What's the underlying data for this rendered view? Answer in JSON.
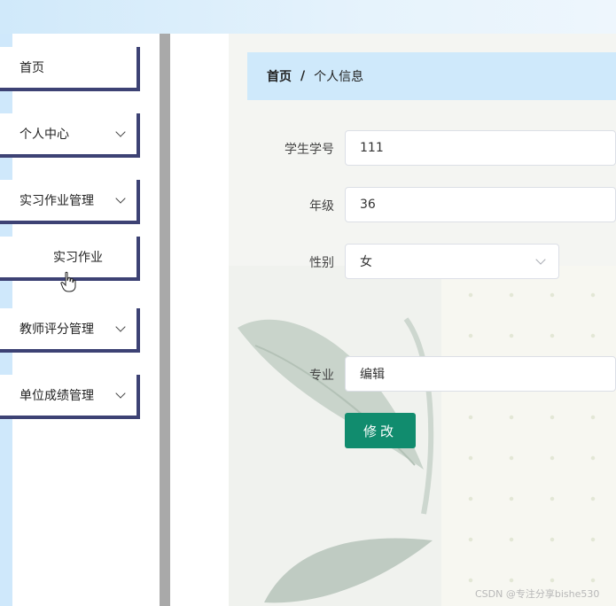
{
  "sidebar": {
    "items": [
      {
        "label": "首页",
        "has_arrow": false
      },
      {
        "label": "个人中心",
        "has_arrow": true
      },
      {
        "label": "实习作业管理",
        "has_arrow": true
      },
      {
        "label": "实习作业",
        "has_arrow": false,
        "submenu": true
      },
      {
        "label": "教师评分管理",
        "has_arrow": true
      },
      {
        "label": "单位成绩管理",
        "has_arrow": true
      }
    ]
  },
  "breadcrumb": {
    "home": "首页",
    "separator": "/",
    "current": "个人信息"
  },
  "form": {
    "student_no_label": "学生学号",
    "student_no_value": "111",
    "grade_label": "年级",
    "grade_value": "36",
    "gender_label": "性别",
    "gender_value": "女",
    "major_label": "专业",
    "major_value": "编辑",
    "submit_label": "修改"
  },
  "watermark": "CSDN @专注分享bishe530",
  "colors": {
    "sidebar_border": "#3d4274",
    "breadcrumb_bg": "#cfe9fb",
    "button_bg": "#118c6e"
  }
}
